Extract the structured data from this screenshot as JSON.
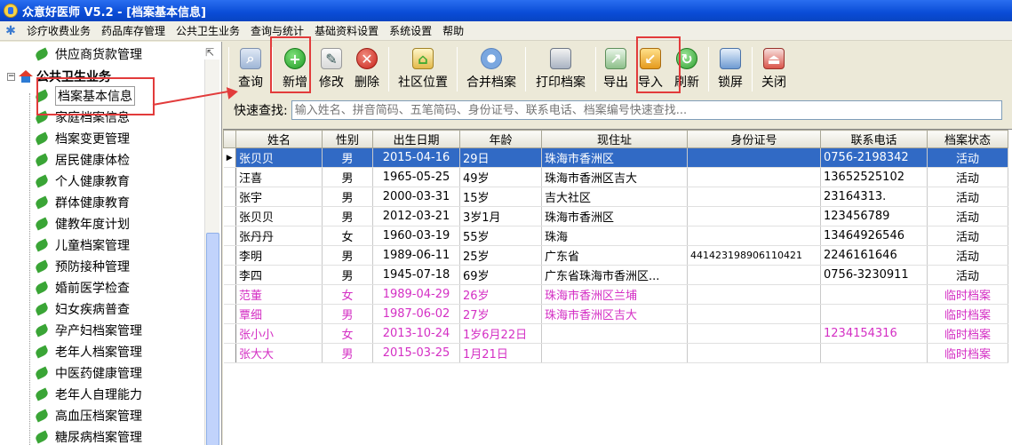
{
  "window": {
    "title": "众意好医师 V5.2 - [档案基本信息]"
  },
  "menu": [
    "诊疗收费业务",
    "药品库存管理",
    "公共卫生业务",
    "查询与统计",
    "基础资料设置",
    "系统设置",
    "帮助"
  ],
  "tree": {
    "top_item": "供应商货款管理",
    "group": "公共卫生业务",
    "items": [
      "档案基本信息",
      "家庭档案信息",
      "档案变更管理",
      "居民健康体检",
      "个人健康教育",
      "群体健康教育",
      "健教年度计划",
      "儿童档案管理",
      "预防接种管理",
      "婚前医学检查",
      "妇女疾病普查",
      "孕产妇档案管理",
      "老年人档案管理",
      "中医药健康管理",
      "老年人自理能力",
      "高血压档案管理",
      "糖尿病档案管理"
    ]
  },
  "toolbar": {
    "query": "查询",
    "add": "新增",
    "edit": "修改",
    "delete": "删除",
    "location": "社区位置",
    "merge": "合并档案",
    "print": "打印档案",
    "export": "导出",
    "import": "导入",
    "refresh": "刷新",
    "lock": "锁屏",
    "close": "关闭"
  },
  "search": {
    "label": "快速查找:",
    "placeholder": "输入姓名、拼音简码、五笔简码、身份证号、联系电话、档案编号快速查找..."
  },
  "table": {
    "columns": [
      "姓名",
      "性别",
      "出生日期",
      "年龄",
      "现住址",
      "身份证号",
      "联系电话",
      "档案状态"
    ],
    "rows": [
      [
        "张贝贝",
        "男",
        "2015-04-16",
        "29日",
        "珠海市香洲区",
        "",
        "0756-2198342",
        "活动"
      ],
      [
        "汪喜",
        "男",
        "1965-05-25",
        "49岁",
        "珠海市香洲区吉大",
        "",
        "13652525102",
        "活动"
      ],
      [
        "张宇",
        "男",
        "2000-03-31",
        "15岁",
        "吉大社区",
        "",
        "23164313.",
        "活动"
      ],
      [
        "张贝贝",
        "男",
        "2012-03-21",
        "3岁1月",
        "珠海市香洲区",
        "",
        "123456789",
        "活动"
      ],
      [
        "张丹丹",
        "女",
        "1960-03-19",
        "55岁",
        "珠海",
        "",
        "13464926546",
        "活动"
      ],
      [
        "李明",
        "男",
        "1989-06-11",
        "25岁",
        "广东省",
        "441423198906110421",
        "2246161646",
        "活动"
      ],
      [
        "李四",
        "男",
        "1945-07-18",
        "69岁",
        "广东省珠海市香洲区...",
        "",
        "0756-3230911",
        "活动"
      ],
      [
        "范董",
        "女",
        "1989-04-29",
        "26岁",
        "珠海市香洲区兰埔",
        "",
        "",
        "临时档案"
      ],
      [
        "覃细",
        "男",
        "1987-06-02",
        "27岁",
        "珠海市香洲区吉大",
        "",
        "",
        "临时档案"
      ],
      [
        "张小小",
        "女",
        "2013-10-24",
        "1岁6月22日",
        "",
        "",
        "1234154316",
        "临时档案"
      ],
      [
        "张大大",
        "男",
        "2015-03-25",
        "1月21日",
        "",
        "",
        "",
        "临时档案"
      ]
    ]
  },
  "colors": {
    "selected_row": "#316ac5",
    "temp_record_text": "#d42fc4",
    "annotation": "#e23b3b"
  }
}
